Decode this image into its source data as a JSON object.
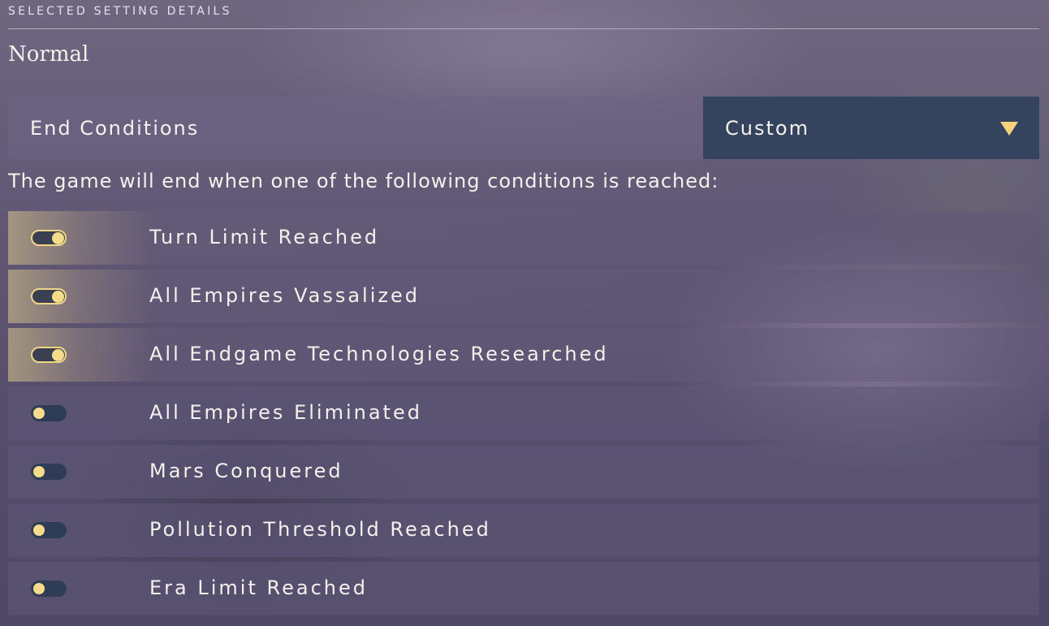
{
  "header": {
    "section_title": "SELECTED SETTING DETAILS",
    "preset_name": "Normal"
  },
  "end_conditions": {
    "label": "End Conditions",
    "dropdown_value": "Custom",
    "dropdown_icon": "triangle-down-icon"
  },
  "description": "The game will end when one of the following conditions is reached:",
  "conditions": [
    {
      "label": "Turn Limit Reached",
      "enabled": true
    },
    {
      "label": "All Empires Vassalized",
      "enabled": true
    },
    {
      "label": "All Endgame Technologies Researched",
      "enabled": true
    },
    {
      "label": "All Empires Eliminated",
      "enabled": false
    },
    {
      "label": "Mars Conquered",
      "enabled": false
    },
    {
      "label": "Pollution Threshold Reached",
      "enabled": false
    },
    {
      "label": "Era Limit Reached",
      "enabled": false
    }
  ],
  "colors": {
    "accent": "#f6d37a",
    "dropdown_bg": "#34445f",
    "toggle_off_bg": "#2f3c56"
  }
}
